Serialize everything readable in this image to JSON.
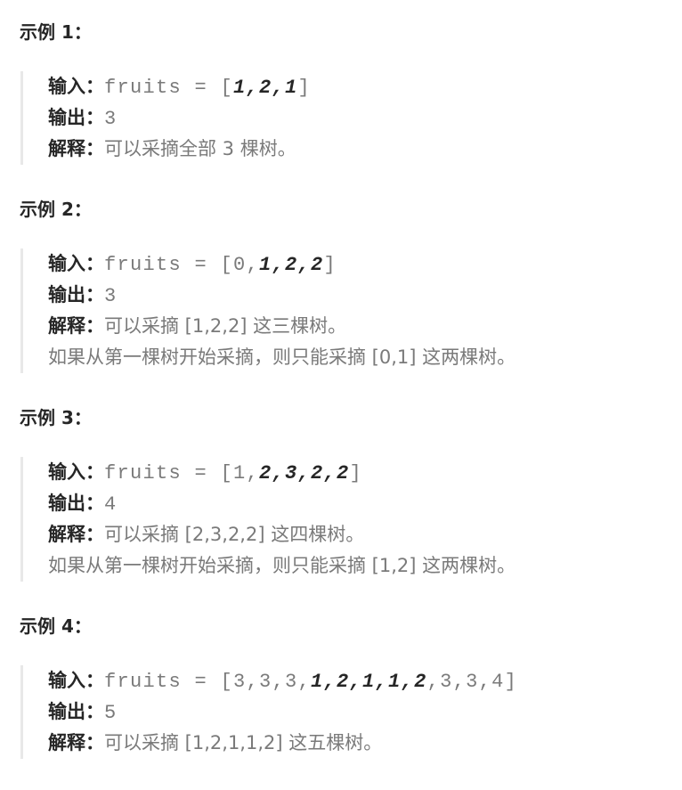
{
  "examples": [
    {
      "heading": "示例 1：",
      "input_label": "输入：",
      "input": [
        {
          "t": "fruits = [",
          "b": false
        },
        {
          "t": "1,2,1",
          "b": true
        },
        {
          "t": "]",
          "b": false
        }
      ],
      "output_label": "输出：",
      "output": "3",
      "explain_label": "解释：",
      "explain": [
        "可以采摘全部 3 棵树。"
      ]
    },
    {
      "heading": "示例 2：",
      "input_label": "输入：",
      "input": [
        {
          "t": "fruits = [0,",
          "b": false
        },
        {
          "t": "1,2,2",
          "b": true
        },
        {
          "t": "]",
          "b": false
        }
      ],
      "output_label": "输出：",
      "output": "3",
      "explain_label": "解释：",
      "explain": [
        "可以采摘 [1,2,2] 这三棵树。",
        "如果从第一棵树开始采摘，则只能采摘 [0,1] 这两棵树。"
      ]
    },
    {
      "heading": "示例 3：",
      "input_label": "输入：",
      "input": [
        {
          "t": "fruits = [1,",
          "b": false
        },
        {
          "t": "2,3,2,2",
          "b": true
        },
        {
          "t": "]",
          "b": false
        }
      ],
      "output_label": "输出：",
      "output": "4",
      "explain_label": "解释：",
      "explain": [
        "可以采摘 [2,3,2,2] 这四棵树。",
        "如果从第一棵树开始采摘，则只能采摘 [1,2] 这两棵树。"
      ]
    },
    {
      "heading": "示例 4：",
      "input_label": "输入：",
      "input": [
        {
          "t": "fruits = [3,3,3,",
          "b": false
        },
        {
          "t": "1,2,1,1,2",
          "b": true
        },
        {
          "t": ",3,3,4]",
          "b": false
        }
      ],
      "output_label": "输出：",
      "output": "5",
      "explain_label": "解释：",
      "explain": [
        "可以采摘 [1,2,1,1,2] 这五棵树。"
      ]
    }
  ]
}
